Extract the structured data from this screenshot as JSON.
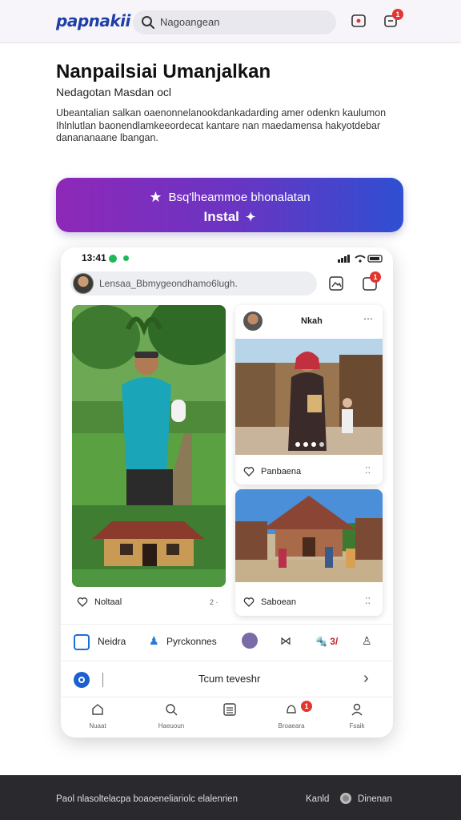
{
  "header": {
    "brand": "papnakii",
    "search_placeholder": "Nagoangean",
    "notif_count": "1"
  },
  "hero": {
    "title": "Nanpailsiai Umanjalkan",
    "subtitle": "Nedagotan Masdan ocl",
    "description": "Ubeantalian salkan oaenonnelanookdankadarding amer odenkn kaulumon Ihlnlutlan baonendlamkeeordecat kantare nan maedamensa hakyotdebar danananaane lbangan."
  },
  "install": {
    "line1": "Bsq'lheammoe bhonalatan",
    "label": "Instal"
  },
  "phone": {
    "time": "13:41",
    "search_placeholder": "Lensaa_Bbmygeondhamo6lugh.",
    "header_badge": "1",
    "card_top_name": "Nkah",
    "card_top_caption": "Panbaena",
    "card_bottom_caption": "Saboean",
    "left_caption": "Noltaal",
    "left_meta": "2 ·",
    "tabs": [
      "Neidra",
      "Pyrckonnes",
      "🔩 3/"
    ],
    "input_text": "Tcum teveshr",
    "nav": [
      "Nuaat",
      "Haeuoun",
      "",
      "Broaeara",
      "Fsaik"
    ],
    "nav_badge": "1"
  },
  "footer": {
    "left": "Paol nlasoltelacpa boaoeneliariolc elalenrien",
    "right1": "Kanld",
    "right2": "Dinenan"
  },
  "colors": {
    "brand": "#1f3fa8",
    "install_start": "#8e28b8",
    "install_end": "#2f4fd2",
    "badge": "#e3342f",
    "footer_bg": "#2a2a2e"
  }
}
